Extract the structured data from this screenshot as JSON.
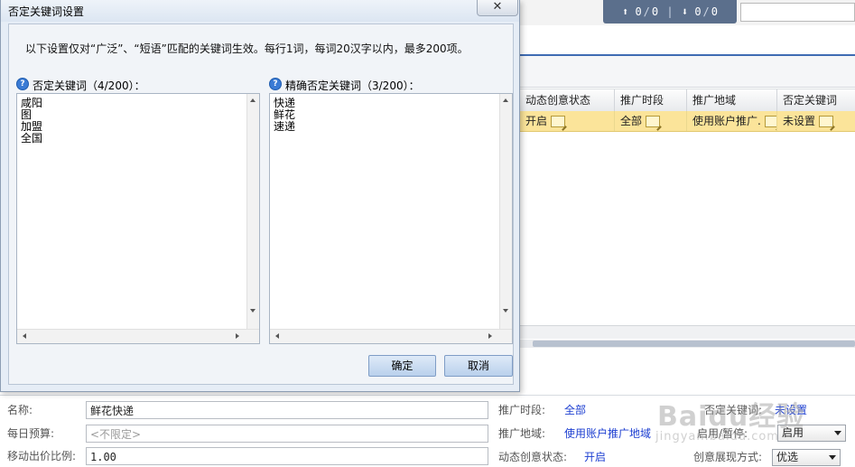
{
  "topbar": {
    "stats": {
      "up_count": "0",
      "up_total": "0",
      "down_count": "0",
      "down_total": "0"
    }
  },
  "grid": {
    "columns": [
      "动态创意状态",
      "推广时段",
      "推广地域",
      "否定关键词"
    ],
    "row": {
      "dynamic_creative": "开启",
      "schedule": "全部",
      "region": "使用账户推广.",
      "negative_keywords": "未设置"
    }
  },
  "form": {
    "name_label": "名称:",
    "name_value": "鲜花快递",
    "budget_label": "每日预算:",
    "budget_placeholder": "<不限定>",
    "mobile_bid_label": "移动出价比例:",
    "mobile_bid_value": "1.00",
    "schedule_label": "推广时段:",
    "schedule_value": "全部",
    "region_label": "推广地域:",
    "region_value": "使用账户推广地域",
    "dynamic_label": "动态创意状态:",
    "dynamic_value": "开启",
    "negative_label": "否定关键词:",
    "negative_value": "未设置",
    "enable_label": "启用/暂停:",
    "enable_value": "启用",
    "display_label": "创意展现方式:",
    "display_value": "优选"
  },
  "watermark": {
    "main": "Baidu经验",
    "sub": "jingyan.baidu.com"
  },
  "dialog": {
    "title": "否定关键词设置",
    "close_glyph": "✕",
    "instruction": "以下设置仅对“广泛”、“短语”匹配的关键词生效。每行1词，每词20汉字以内，最多200项。",
    "help_glyph": "?",
    "negative": {
      "label": "否定关键词（4/200）：",
      "items": [
        "咸阳",
        "图",
        "加盟",
        "全国"
      ]
    },
    "exact_negative": {
      "label": "精确否定关键词（3/200）：",
      "items": [
        "快递",
        "鲜花",
        "速递"
      ]
    },
    "ok_label": "确定",
    "cancel_label": "取消"
  }
}
